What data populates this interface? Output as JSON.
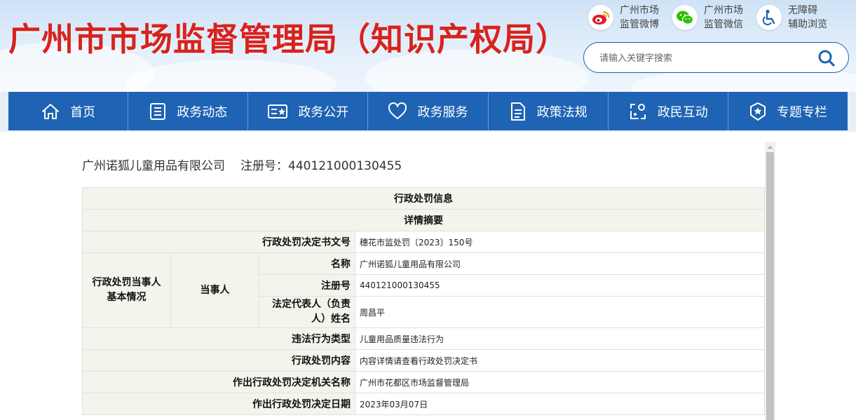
{
  "header": {
    "site_title": "广州市市场监督管理局（知识产权局）",
    "quick_links": [
      {
        "icon": "weibo-icon",
        "line1": "广州市场",
        "line2": "监管微博"
      },
      {
        "icon": "wechat-icon",
        "line1": "广州市场",
        "line2": "监管微信"
      },
      {
        "icon": "accessibility-icon",
        "line1": "无障碍",
        "line2": "辅助浏览"
      }
    ],
    "search": {
      "placeholder": "请输入关键字搜索",
      "value": ""
    }
  },
  "nav": {
    "items": [
      {
        "label": "首页",
        "icon": "home-icon"
      },
      {
        "label": "政务动态",
        "icon": "document-list-icon"
      },
      {
        "label": "政务公开",
        "icon": "bulletin-icon"
      },
      {
        "label": "政务服务",
        "icon": "heart-icon"
      },
      {
        "label": "政策法规",
        "icon": "file-icon"
      },
      {
        "label": "政民互动",
        "icon": "interaction-icon"
      },
      {
        "label": "专题专栏",
        "icon": "star-badge-icon"
      }
    ]
  },
  "record": {
    "company": "广州诺狐儿童用品有限公司",
    "reg_label": "注册号：",
    "reg_no": "440121000130455"
  },
  "table": {
    "title": "行政处罚信息",
    "subtitle": "详情摘要",
    "doc_no_label": "行政处罚决定书文号",
    "doc_no": "穗花市监处罚〔2023〕150号",
    "party_category_line1": "行政处罚当事人",
    "party_category_line2": "基本情况",
    "party_label": "当事人",
    "name_label": "名称",
    "name": "广州诺狐儿童用品有限公司",
    "reg_label": "注册号",
    "reg_no": "440121000130455",
    "rep_label_line1": "法定代表人（负责",
    "rep_label_line2": "人）姓名",
    "rep": "周昌平",
    "violation_type_label": "违法行为类型",
    "violation_type": "儿童用品质量违法行为",
    "penalty_content_label": "行政处罚内容",
    "penalty_content": "内容详情请查看行政处罚决定书",
    "authority_label": "作出行政处罚决定机关名称",
    "authority": "广州市花都区市场监督管理局",
    "date_label": "作出行政处罚决定日期",
    "date": "2023年03月07日"
  },
  "colors": {
    "title_red": "#d7231e",
    "nav_blue": "#1e63b4",
    "table_bg": "#f3f5ec"
  }
}
